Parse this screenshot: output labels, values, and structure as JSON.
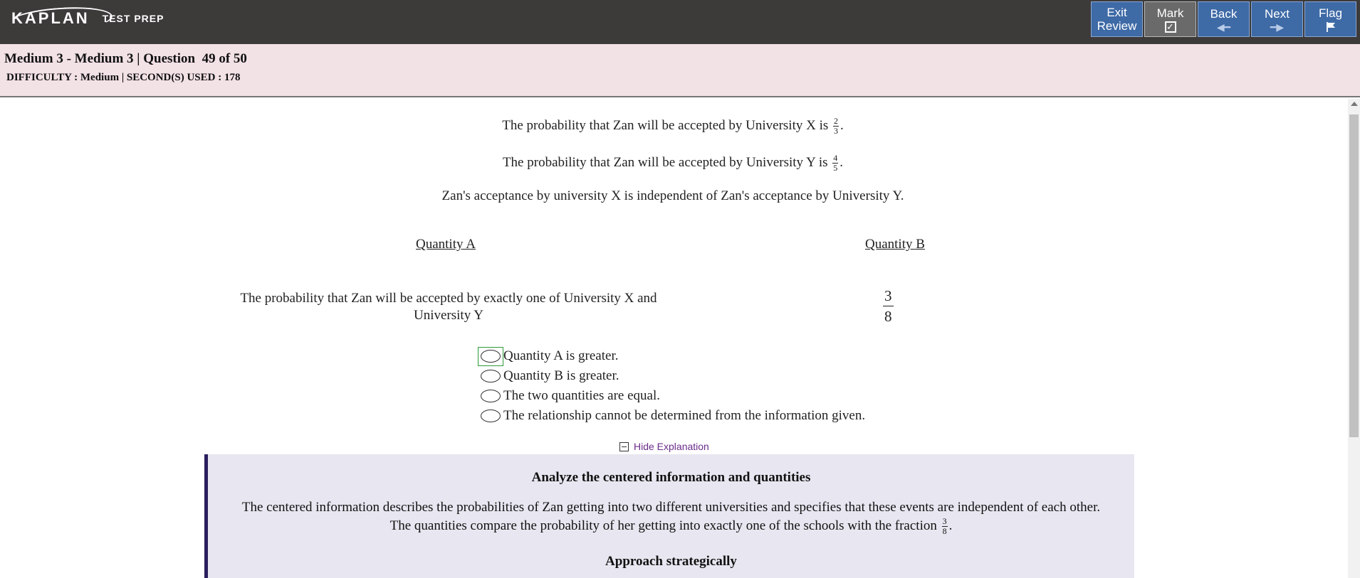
{
  "brand": {
    "logo_text": "KAPLAN",
    "sub_text": "TEST PREP"
  },
  "nav": {
    "exit_line1": "Exit",
    "exit_line2": "Review",
    "mark": "Mark",
    "back": "Back",
    "next": "Next",
    "flag": "Flag"
  },
  "header": {
    "title": "Medium 3 - Medium 3 | Question  49 of 50",
    "meta": "DIFFICULTY : Medium | SECOND(S) USED : 178"
  },
  "stem": {
    "line1_pre": "The probability that Zan will be accepted by University X is",
    "line1_num": "2",
    "line1_den": "3",
    "line1_post": ".",
    "line2_pre": "The probability that Zan will be accepted by University Y is",
    "line2_num": "4",
    "line2_den": "5",
    "line2_post": ".",
    "line3": "Zan's acceptance by university X is independent of Zan's acceptance by University Y."
  },
  "quantities": {
    "a_head": "Quantity A",
    "b_head": "Quantity B",
    "a_text": "The probability that Zan will be accepted by exactly one of University X and University Y",
    "b_num": "3",
    "b_den": "8"
  },
  "choices": [
    {
      "label": "Quantity A is greater."
    },
    {
      "label": "Quantity B is greater."
    },
    {
      "label": "The two quantities are equal."
    },
    {
      "label": "The relationship cannot be determined from the information given."
    }
  ],
  "explanation": {
    "toggle_label": "Hide Explanation",
    "heading1": "Analyze the centered information and quantities",
    "para1_line1": "The centered information describes the probabilities of Zan getting into two different universities and specifies that these events are independent of each other.",
    "para1_line2_pre": "The quantities compare the probability of her getting into exactly one of the schools with the fraction",
    "para1_num": "3",
    "para1_den": "8",
    "para1_post": ".",
    "heading2": "Approach strategically"
  },
  "colors": {
    "topbar": "#3d3a3a",
    "nav_button": "#3e6aa6",
    "mark_button": "#6a6a6a",
    "header_bg": "#f2e1e5",
    "explanation_bg": "#e8e6f0",
    "explanation_border": "#2a1e5c",
    "toggle_link": "#6a2d8a"
  }
}
